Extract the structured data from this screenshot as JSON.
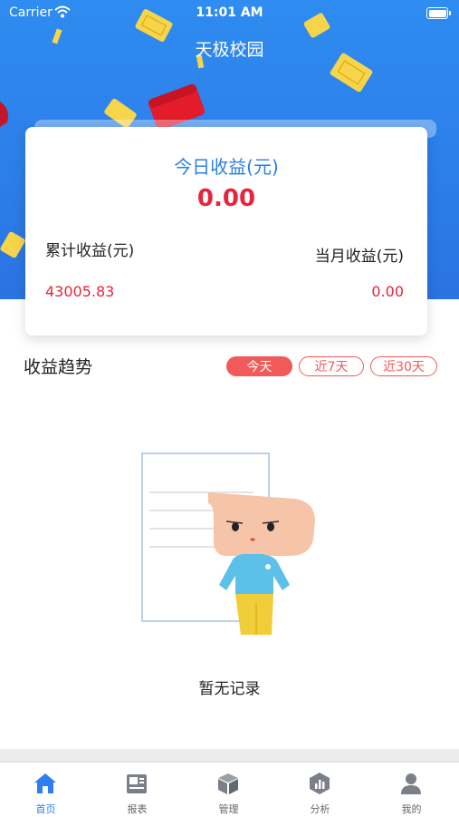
{
  "status_bar": {
    "carrier": "Carrier",
    "time": "11:01 AM"
  },
  "nav": {
    "title": "天极校园"
  },
  "summary": {
    "today_label": "今日收益(元)",
    "today_value": "0.00",
    "total_label": "累计收益(元)",
    "total_value": "43005.83",
    "month_label": "当月收益(元)",
    "month_value": "0.00"
  },
  "trend": {
    "title": "收益趋势",
    "ranges": [
      {
        "label": "今天",
        "active": true
      },
      {
        "label": "近7天",
        "active": false
      },
      {
        "label": "近30天",
        "active": false
      }
    ]
  },
  "empty_state": {
    "text": "暂无记录"
  },
  "tabs": [
    {
      "label": "首页",
      "icon": "home-icon",
      "active": true
    },
    {
      "label": "报表",
      "icon": "report-icon",
      "active": false
    },
    {
      "label": "管理",
      "icon": "box-icon",
      "active": false
    },
    {
      "label": "分析",
      "icon": "analysis-icon",
      "active": false
    },
    {
      "label": "我的",
      "icon": "user-icon",
      "active": false
    }
  ],
  "colors": {
    "header_blue": "#2c7fe9",
    "accent_red": "#e8243c",
    "tab_active": "#2d7ff0",
    "chip_red": "#f05a5a"
  }
}
